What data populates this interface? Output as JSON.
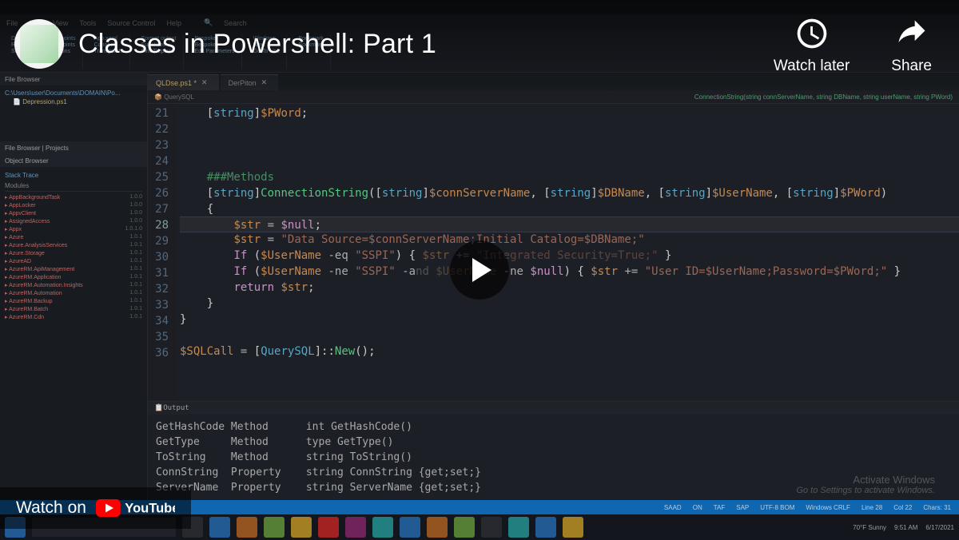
{
  "youtube": {
    "title": "Classes in Powershell: Part 1",
    "watch_later": "Watch later",
    "share": "Share",
    "watch_on": "Watch on"
  },
  "ide": {
    "menus": [
      "File",
      "Edit",
      "View",
      "Tools",
      "Source Control",
      "Help"
    ],
    "search_label": "Search",
    "ribbon": {
      "groups": [
        [
          "Debug",
          "Run",
          "Stop"
        ],
        [
          "Breakpoints",
          "Transpoints",
          "Functions"
        ],
        [
          "App.xaml",
          "Connect",
          "Transpoints"
        ],
        [
          "Format output",
          "Functions",
          "Find/Replace"
        ],
        [
          "Bespoke",
          "Bespoke",
          "Edit Parameters"
        ],
        [
          "Windows",
          "Next",
          "Go To Line"
        ],
        [
          "Bookmark",
          "Bookmark"
        ]
      ]
    },
    "file_browser": {
      "head": "File Browser",
      "path_label": "C:\\Users\\user\\Documents\\DOMAIN\\Po...",
      "file": "Depression.ps1"
    },
    "projects": {
      "head": "File Browser | Projects",
      "obj_head": "Object Browser",
      "stack_label": "Stack Trace",
      "modules_label": "Modules",
      "items": [
        [
          "AppBackgroundTask",
          "1.0.0"
        ],
        [
          "AppLocker",
          "1.0.0"
        ],
        [
          "AppvClient",
          "1.0.0"
        ],
        [
          "AssignedAccess",
          "1.0.0"
        ],
        [
          "Appx",
          "1.0.1.0"
        ],
        [
          "Azure",
          "1.0.1"
        ],
        [
          "Azure.AnalysisServices",
          "1.0.1"
        ],
        [
          "Azure.Storage",
          "1.0.1"
        ],
        [
          "AzureAD",
          "1.0.1"
        ],
        [
          "AzureRM.ApiManagement",
          "1.0.1"
        ],
        [
          "AzureRM.Application",
          "1.0.1"
        ],
        [
          "AzureRM.Automation.Insights",
          "1.0.1"
        ],
        [
          "AzureRM.Automation",
          "1.0.1"
        ],
        [
          "AzureRM.Backup",
          "1.0.1"
        ],
        [
          "AzureRM.Batch",
          "1.0.1"
        ],
        [
          "AzureRM.Cdn",
          "1.0.1"
        ]
      ]
    },
    "tabs": [
      {
        "label": "QLDse.ps1 *",
        "active": true
      },
      {
        "label": "DerPiton",
        "active": false
      }
    ],
    "crumb_class": "QuerySQL",
    "crumb_method": "ConnectionString(string connServerName, string DBName, string userName, string PWord)",
    "gutter": [
      "21",
      "22",
      "23",
      "24",
      "25",
      "26",
      "27",
      "28",
      "29",
      "30",
      "31",
      "32",
      "33",
      "34",
      "35",
      "36"
    ],
    "code": {
      "l21": "    [string]$PWord;",
      "l25": "    ###Methods",
      "l26": "    [string]ConnectionString([string]$connServerName, [string]$DBName, [string]$UserName, [string]$PWord)",
      "l27": "    {",
      "l28": "        $str = $null;",
      "l29": "        $str = \"Data Source=$connServerName;Initial Catalog=$DBName;\"",
      "l30": "        If ($UserName -eq \"SSPI\") { $str += \"Integrated Security=True;\" }",
      "l31": "        If ($UserName -ne \"SSPI\" -and $UserName -ne $null) { $str += \"User ID=$UserName;Password=$PWord;\" }",
      "l32": "        return $str;",
      "l33": "    }",
      "l34": "}",
      "l36": "$SQLCall = [QuerySQL]::New();"
    },
    "output": {
      "head": "Output",
      "rows": [
        [
          "GetHashCode",
          "Method",
          "int GetHashCode()"
        ],
        [
          "GetType",
          "Method",
          "type GetType()"
        ],
        [
          "ToString",
          "Method",
          "string ToString()"
        ],
        [
          "ConnString",
          "Property",
          "string ConnString {get;set;}"
        ],
        [
          "ServerName",
          "Property",
          "string ServerName {get;set;}"
        ]
      ]
    },
    "watermark": {
      "title": "Activate Windows",
      "sub": "Go to Settings to activate Windows."
    },
    "statusbar": [
      "SAAD",
      "ON",
      "TAF",
      "SAP",
      "UTF-8 BOM",
      "Windows CRLF",
      "Line 28",
      "Col 22",
      "Chars: 31"
    ],
    "taskbar_right": [
      "70°F Sunny",
      "9:51 AM",
      "6/17/2021"
    ]
  }
}
